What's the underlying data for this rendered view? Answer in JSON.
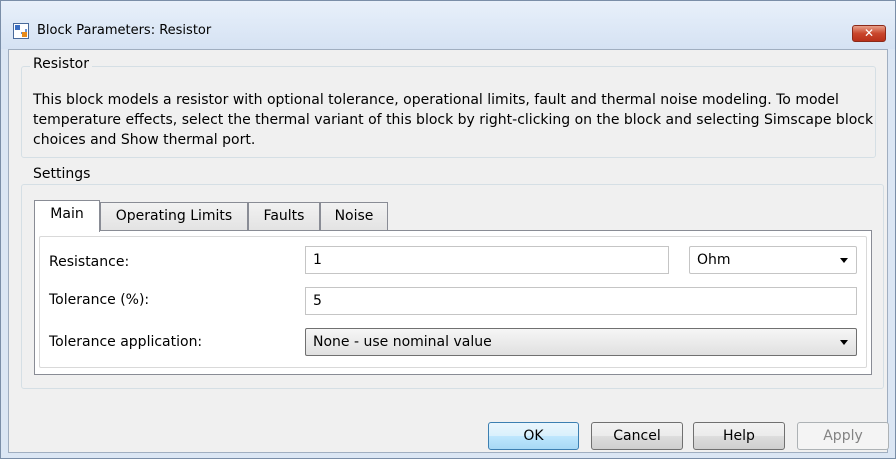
{
  "window": {
    "title": "Block Parameters: Resistor",
    "close_glyph": "✕"
  },
  "description_group": {
    "label": "Resistor",
    "text": "This block models a resistor with optional tolerance, operational limits, fault and thermal noise modeling. To model temperature effects, select the thermal variant of this block by right-clicking on the block and selecting Simscape block choices and Show thermal port."
  },
  "settings_group": {
    "label": "Settings",
    "tabs": [
      {
        "label": "Main",
        "active": true
      },
      {
        "label": "Operating Limits",
        "active": false
      },
      {
        "label": "Faults",
        "active": false
      },
      {
        "label": "Noise",
        "active": false
      }
    ],
    "fields": {
      "resistance": {
        "label": "Resistance:",
        "value": "1",
        "unit": "Ohm"
      },
      "tolerance": {
        "label": "Tolerance (%):",
        "value": "5"
      },
      "tolerance_application": {
        "label": "Tolerance application:",
        "value": "None - use nominal value"
      }
    }
  },
  "buttons": {
    "ok": "OK",
    "cancel": "Cancel",
    "help": "Help",
    "apply": "Apply"
  },
  "icons": {
    "title_icon": "simulink-block-icon",
    "close": "close-icon",
    "dropdown": "chevron-down-icon"
  },
  "colors": {
    "title_bar": "#dbe6f4",
    "close_button": "#c9462c",
    "default_button_border": "#3c7fb1"
  }
}
